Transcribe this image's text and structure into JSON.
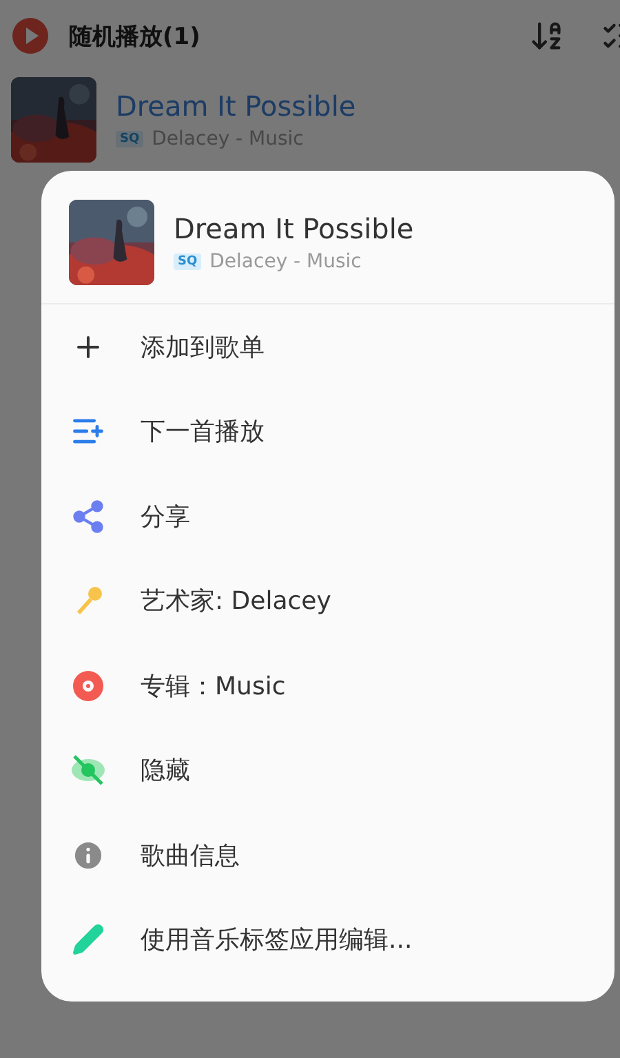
{
  "header": {
    "title": "随机播放(1)"
  },
  "song_row": {
    "title": "Dream It Possible",
    "quality": "SQ",
    "subtitle": "Delacey - Music"
  },
  "sheet": {
    "song": {
      "title": "Dream It Possible",
      "quality": "SQ",
      "subtitle": "Delacey - Music"
    },
    "items": [
      {
        "kind": "add",
        "label": "添加到歌单"
      },
      {
        "kind": "next",
        "label": "下一首播放"
      },
      {
        "kind": "share",
        "label": "分享"
      },
      {
        "kind": "artist",
        "label": "艺术家: Delacey"
      },
      {
        "kind": "album",
        "label": "专辑：Music"
      },
      {
        "kind": "hide",
        "label": "隐藏"
      },
      {
        "kind": "info",
        "label": "歌曲信息"
      },
      {
        "kind": "edit",
        "label": "使用音乐标签应用编辑..."
      }
    ]
  }
}
